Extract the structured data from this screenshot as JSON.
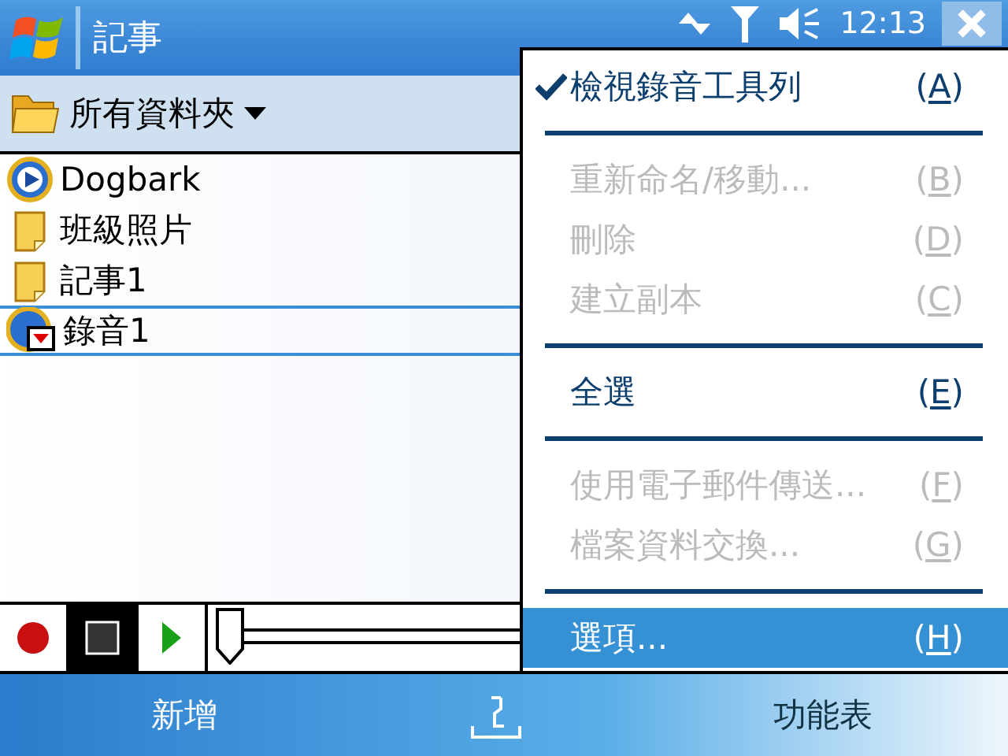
{
  "title_bar": {
    "title": "記事",
    "time": "12:13"
  },
  "folder_bar": {
    "label": "所有資料夾"
  },
  "files": [
    {
      "name": "Dogbark",
      "kind": "media",
      "selected": false
    },
    {
      "name": "班級照片",
      "kind": "note",
      "selected": false
    },
    {
      "name": "記事1",
      "kind": "note",
      "selected": false
    },
    {
      "name": "錄音1",
      "kind": "recording",
      "selected": true
    }
  ],
  "recorder": {
    "level": 0
  },
  "menu": [
    {
      "kind": "item",
      "label": "檢視錄音工具列",
      "shortcut": "(A)",
      "checked": true,
      "disabled": false,
      "selected": false
    },
    {
      "kind": "separator"
    },
    {
      "kind": "item",
      "label": "重新命名/移動...",
      "shortcut": "(B)",
      "checked": false,
      "disabled": true,
      "selected": false
    },
    {
      "kind": "item",
      "label": "刪除",
      "shortcut": "(D)",
      "checked": false,
      "disabled": true,
      "selected": false
    },
    {
      "kind": "item",
      "label": "建立副本",
      "shortcut": "(C)",
      "checked": false,
      "disabled": true,
      "selected": false
    },
    {
      "kind": "separator"
    },
    {
      "kind": "item",
      "label": "全選",
      "shortcut": "(E)",
      "checked": false,
      "disabled": false,
      "selected": false
    },
    {
      "kind": "separator"
    },
    {
      "kind": "item",
      "label": "使用電子郵件傳送...",
      "shortcut": "(F)",
      "checked": false,
      "disabled": true,
      "selected": false
    },
    {
      "kind": "item",
      "label": "檔案資料交換...",
      "shortcut": "(G)",
      "checked": false,
      "disabled": true,
      "selected": false
    },
    {
      "kind": "separator"
    },
    {
      "kind": "item",
      "label": "選項...",
      "shortcut": "(H)",
      "checked": false,
      "disabled": false,
      "selected": true
    }
  ],
  "softkeys": {
    "left": "新增",
    "right": "功能表"
  }
}
